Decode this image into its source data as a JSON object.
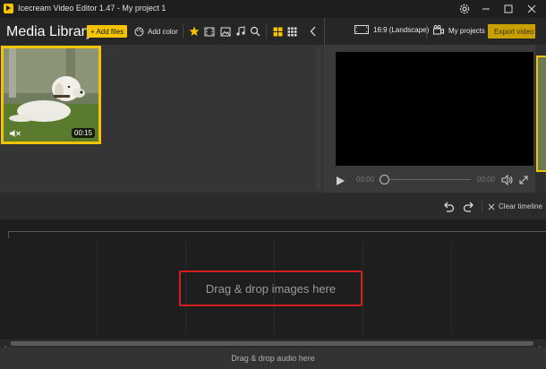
{
  "window": {
    "title": "Icecream Video Editor 1.47  -  My project 1",
    "controls": [
      "settings-icon",
      "minimize-icon",
      "maximize-icon",
      "close-icon"
    ]
  },
  "toolbar": {
    "media_title": "Media Library",
    "add_files_label": "+ Add files",
    "add_color_label": "Add color",
    "filters": [
      "star-icon",
      "video-filter-icon",
      "image-filter-icon",
      "music-filter-icon",
      "search-icon"
    ],
    "views": [
      "large-grid-icon",
      "small-grid-icon"
    ],
    "collapse_icon": "chevron-left-icon"
  },
  "media": {
    "items": [
      {
        "duration": "00:15",
        "muted": true,
        "selected": true
      }
    ]
  },
  "preview_header": {
    "aspect_label": "16:9 (Landscape)",
    "my_projects_label": "My projects",
    "export_label": "Export video"
  },
  "player": {
    "current_time": "00:00",
    "total_time": "00:00",
    "progress": 0
  },
  "timeline_toolbar": {
    "clear_label": "Clear timeline"
  },
  "timeline": {
    "drop_images_label": "Drag & drop images here",
    "drop_audio_label": "Drag & drop audio here"
  },
  "colors": {
    "accent": "#f5c400",
    "highlight_border": "#d41e1e"
  }
}
